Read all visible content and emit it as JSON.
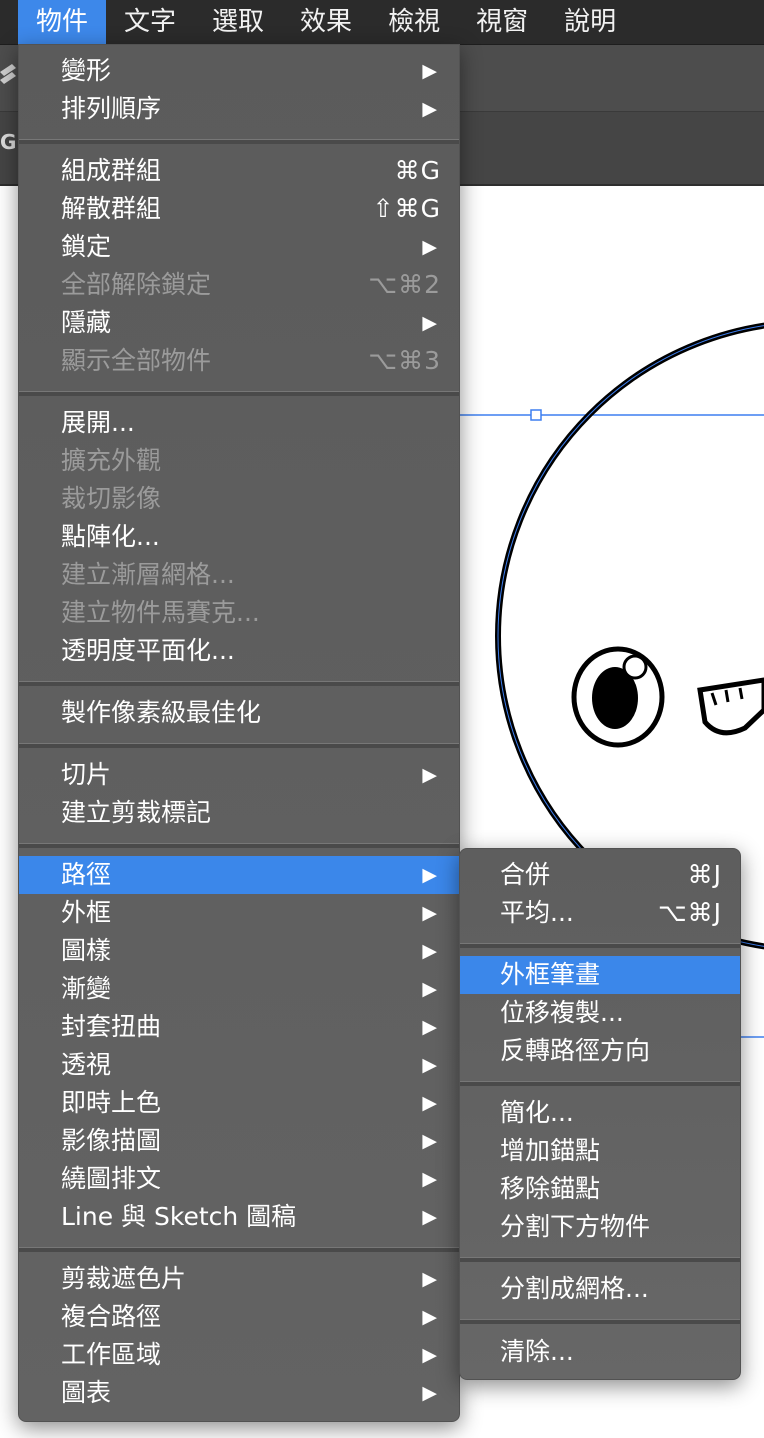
{
  "menubar": {
    "items": [
      "物件",
      "文字",
      "選取",
      "效果",
      "檢視",
      "視窗",
      "說明"
    ]
  },
  "toolbar": {
    "cut_label": "GI"
  },
  "object_menu": {
    "transform": "變形",
    "arrange": "排列順序",
    "group": "組成群組",
    "group_sc": "⌘G",
    "ungroup": "解散群組",
    "ungroup_sc": "⇧⌘G",
    "lock": "鎖定",
    "unlock_all": "全部解除鎖定",
    "unlock_all_sc": "⌥⌘2",
    "hide": "隱藏",
    "show_all": "顯示全部物件",
    "show_all_sc": "⌥⌘3",
    "expand": "展開...",
    "expand_appearance": "擴充外觀",
    "crop_image": "裁切影像",
    "rasterize": "點陣化...",
    "gradient_mesh": "建立漸層網格...",
    "object_mosaic": "建立物件馬賽克...",
    "flatten_transparency": "透明度平面化...",
    "pixel_perfect": "製作像素級最佳化",
    "slice": "切片",
    "trim_marks": "建立剪裁標記",
    "path": "路徑",
    "shape": "外框",
    "pattern": "圖樣",
    "blend": "漸變",
    "envelope_distort": "封套扭曲",
    "perspective": "透視",
    "live_paint": "即時上色",
    "image_trace": "影像描圖",
    "text_wrap": "繞圖排文",
    "line_sketch": "Line 與 Sketch 圖稿",
    "clipping_mask": "剪裁遮色片",
    "compound_path": "複合路徑",
    "artboards": "工作區域",
    "graph": "圖表"
  },
  "path_submenu": {
    "join": "合併",
    "join_sc": "⌘J",
    "average": "平均...",
    "average_sc": "⌥⌘J",
    "outline_stroke": "外框筆畫",
    "offset_path": "位移複製...",
    "reverse_direction": "反轉路徑方向",
    "simplify": "簡化...",
    "add_anchor": "增加錨點",
    "remove_anchor": "移除錨點",
    "divide_below": "分割下方物件",
    "split_grid": "分割成網格...",
    "clean_up": "清除..."
  },
  "arrow_glyph": "▶",
  "colors": {
    "highlight": "#3b87ea",
    "menu_bg": "#606060",
    "disabled": "#9b9b9b",
    "selection": "#3d7ff0"
  }
}
